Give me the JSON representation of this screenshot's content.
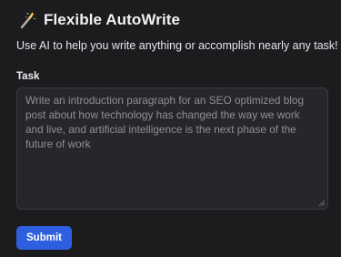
{
  "app": {
    "title": "Flexible AutoWrite",
    "icon": "magic-wand-icon",
    "subtitle": "Use AI to help you write anything or accomplish nearly any task!"
  },
  "task": {
    "label": "Task",
    "placeholder": "Write an introduction paragraph for an SEO optimized blog post about how technology has changed the way we work and live, and artificial intelligence is the next phase of the future of work",
    "value": ""
  },
  "actions": {
    "submit_label": "Submit"
  },
  "colors": {
    "background": "#1c1c1f",
    "field_background": "#27272b",
    "accent": "#2e5fe0",
    "placeholder_text": "#8e8e95"
  }
}
